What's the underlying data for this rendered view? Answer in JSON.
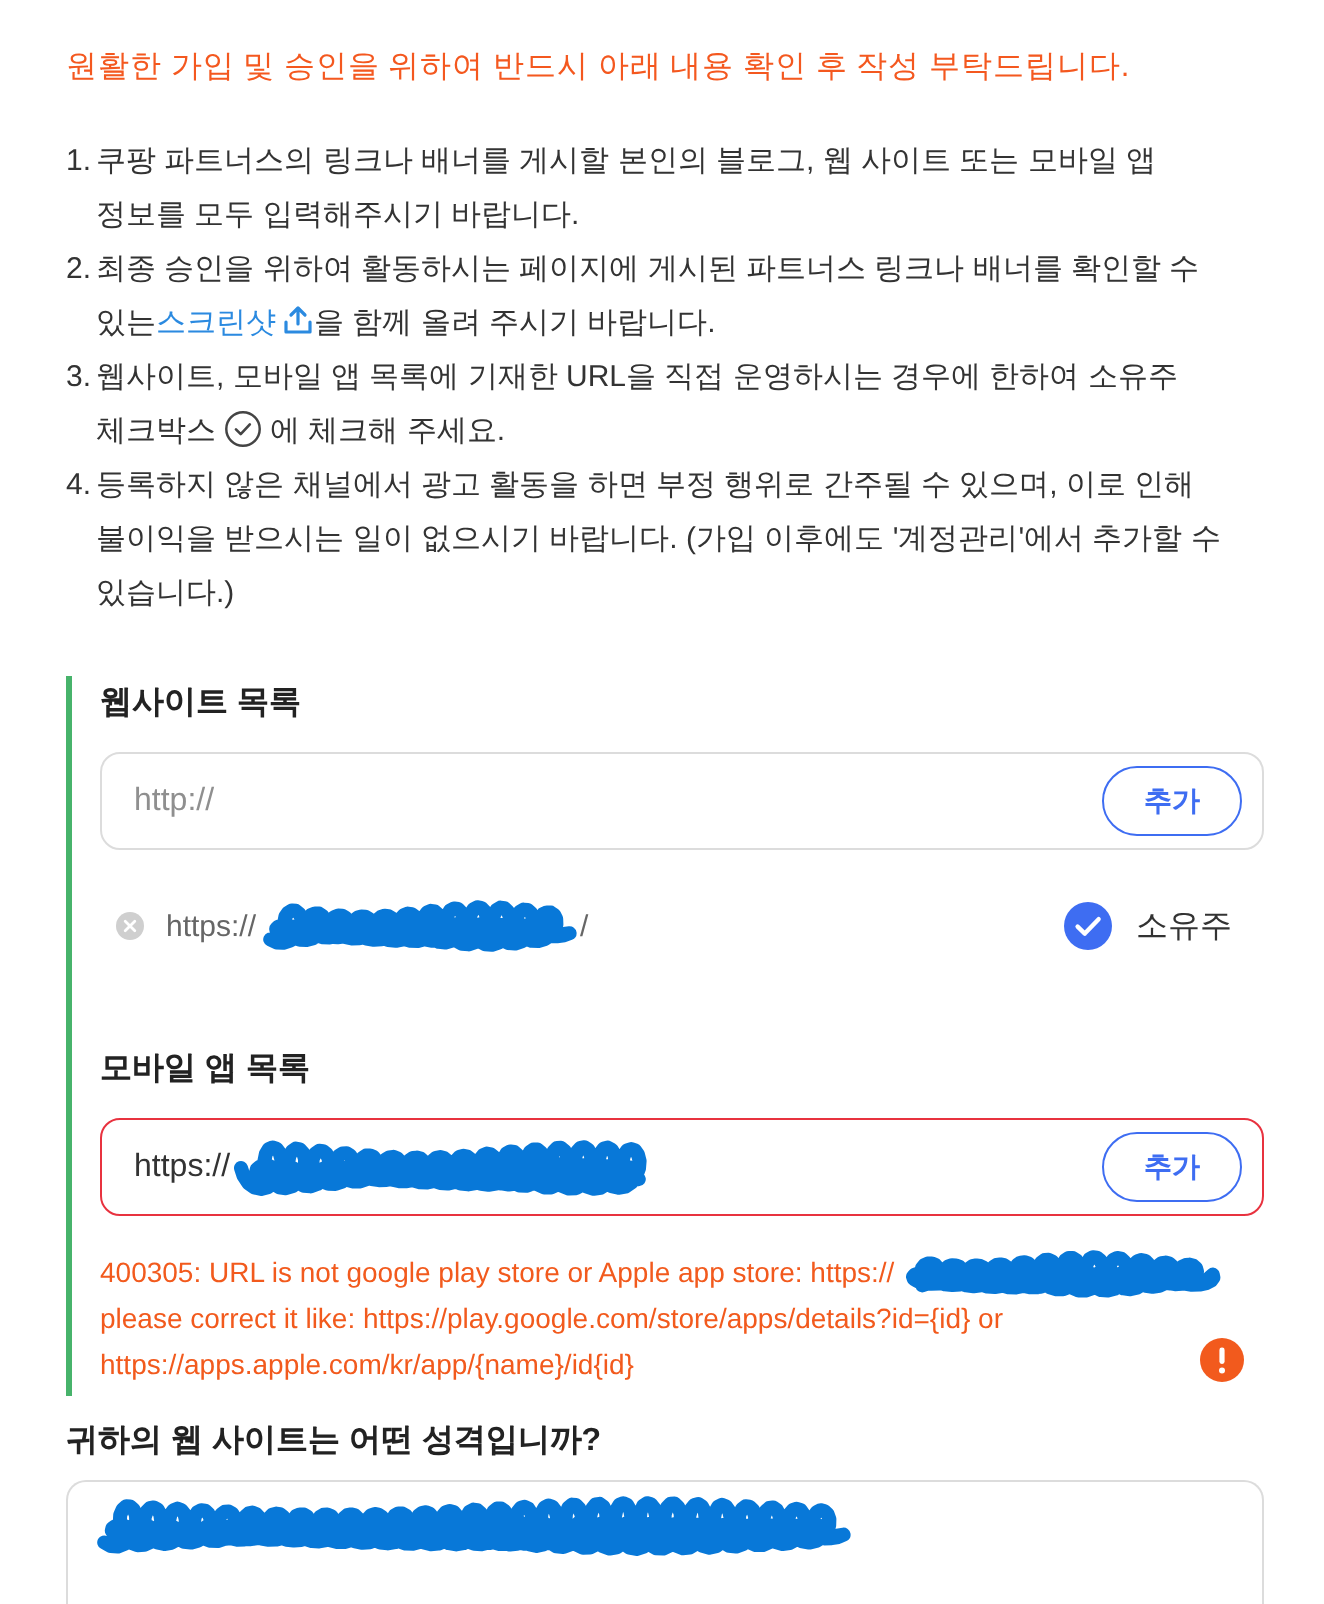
{
  "notice": "원활한 가입 및 승인을 위하여 반드시 아래 내용 확인 후 작성 부탁드립니다.",
  "instructions": [
    {
      "number": "1.",
      "kind": "plain",
      "text": "쿠팡 파트너스의 링크나 배너를 게시할 본인의 블로그, 웹 사이트 또는 모바일 앱 정보를 모두 입력해주시기 바랍니다."
    },
    {
      "number": "2.",
      "kind": "link",
      "text_before": "최종 승인을 위하여 활동하시는 페이지에 게시된 파트너스 링크나 배너를 확인할 수 있는",
      "link": "스크린샷",
      "text_after": "을 함께 올려 주시기 바랍니다."
    },
    {
      "number": "3.",
      "kind": "icon",
      "text_before": "웹사이트, 모바일 앱 목록에 기재한 URL을 직접 운영하시는 경우에 한하여 소유주 체크박스",
      "text_after": "에 체크해 주세요."
    },
    {
      "number": "4.",
      "kind": "plain",
      "text": "등록하지 않은 채널에서 광고 활동을 하면 부정 행위로 간주될 수 있으며, 이로 인해 불이익을 받으시는 일이 없으시기 바랍니다. (가입 이후에도 '계정관리'에서 추가할 수 있습니다.)"
    }
  ],
  "website_list": {
    "title": "웹사이트 목록",
    "input": {
      "placeholder": "http://",
      "invalid": false,
      "button": "추가"
    },
    "items": [
      {
        "url_start": "https://",
        "redacted": true,
        "url_end": "/",
        "owner_label": "소유주",
        "owner_checked": true
      }
    ]
  },
  "app_list": {
    "title": "모바일 앱 목록",
    "input": {
      "value": "https://",
      "redacted": true,
      "invalid": true,
      "button": "추가"
    },
    "error": {
      "message_start": "400305: URL is not google play store or Apple app store: https://",
      "redacted": true,
      "message_end": "please correct it like: https://play.google.com/store/apps/details?id={id} or https://apps.apple.com/kr/app/{name}/id{id}"
    }
  },
  "question": {
    "title": "귀하의 웹 사이트는 어떤 성격입니까?",
    "answer": {
      "redacted": true
    }
  }
}
